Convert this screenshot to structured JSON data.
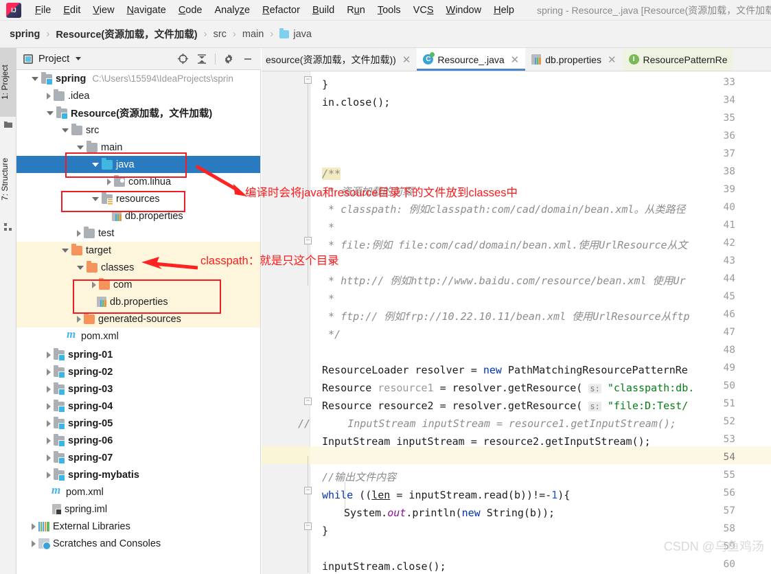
{
  "window": {
    "title": "spring - Resource_.java [Resource(资源加载，文件加载)"
  },
  "menubar": {
    "items": [
      {
        "label": "File"
      },
      {
        "label": "Edit"
      },
      {
        "label": "View"
      },
      {
        "label": "Navigate"
      },
      {
        "label": "Code"
      },
      {
        "label": "Analyze"
      },
      {
        "label": "Refactor"
      },
      {
        "label": "Build"
      },
      {
        "label": "Run"
      },
      {
        "label": "Tools"
      },
      {
        "label": "VCS"
      },
      {
        "label": "Window"
      },
      {
        "label": "Help"
      }
    ],
    "logo_icon": "intellij-idea-logo"
  },
  "breadcrumb": {
    "items": [
      {
        "label": "spring",
        "bold": true
      },
      {
        "label": "Resource(资源加载，文件加载)",
        "bold": true
      },
      {
        "label": "src",
        "bold": false
      },
      {
        "label": "main",
        "bold": false
      },
      {
        "label": "java",
        "bold": false,
        "icon": "folder-icon"
      }
    ],
    "separator": "›"
  },
  "tool_tabs": [
    {
      "label": "1: Project",
      "selected": true,
      "icon": "project-folder-icon"
    },
    {
      "label": "7: Structure",
      "selected": false,
      "icon": "structure-icon"
    }
  ],
  "project_panel": {
    "title": "Project",
    "title_icon": "project-icon",
    "dropdown_icon": "chevron-down-icon",
    "toolbar": [
      {
        "name": "locate-icon",
        "glyph": "⊕"
      },
      {
        "name": "collapse-all-icon",
        "glyph": "⬍"
      },
      {
        "name": "gear-icon",
        "glyph": "⚙"
      },
      {
        "name": "hide-icon",
        "glyph": "−"
      }
    ],
    "tree": [
      {
        "indent": 0,
        "arrow": "down",
        "icon": "module-folder-icon",
        "label": "spring",
        "bold": true,
        "path": "C:\\Users\\15594\\IdeaProjects\\sprin"
      },
      {
        "indent": 1,
        "arrow": "right",
        "icon": "folder-icon",
        "label": ".idea",
        "bold": false,
        "path": ""
      },
      {
        "indent": 1,
        "arrow": "down",
        "icon": "module-folder-icon",
        "label": "Resource(资源加载，文件加载)",
        "bold": true,
        "path": ""
      },
      {
        "indent": 2,
        "arrow": "down",
        "icon": "folder-icon",
        "label": "src",
        "bold": false,
        "path": ""
      },
      {
        "indent": 3,
        "arrow": "down",
        "icon": "folder-icon",
        "label": "main",
        "bold": false,
        "path": ""
      },
      {
        "indent": 4,
        "arrow": "down",
        "icon": "source-folder-icon",
        "label": "java",
        "bold": false,
        "path": "",
        "selected": true
      },
      {
        "indent": 5,
        "arrow": "right",
        "icon": "package-icon",
        "label": "com.lihua",
        "bold": false,
        "path": ""
      },
      {
        "indent": 4,
        "arrow": "down",
        "icon": "resources-folder-icon",
        "label": "resources",
        "bold": false,
        "path": ""
      },
      {
        "indent": 5,
        "arrow": "none",
        "icon": "properties-file-icon",
        "label": "db.properties",
        "bold": false,
        "path": ""
      },
      {
        "indent": 3,
        "arrow": "right",
        "icon": "folder-icon",
        "label": "test",
        "bold": false,
        "path": ""
      },
      {
        "indent": 2,
        "arrow": "down",
        "icon": "target-folder-icon",
        "label": "target",
        "bold": false,
        "path": "",
        "yellow": true
      },
      {
        "indent": 3,
        "arrow": "down",
        "icon": "target-folder-icon",
        "label": "classes",
        "bold": false,
        "path": "",
        "yellow": true
      },
      {
        "indent": 4,
        "arrow": "right",
        "icon": "target-folder-icon",
        "label": "com",
        "bold": false,
        "path": "",
        "yellow": true
      },
      {
        "indent": 4,
        "arrow": "none",
        "icon": "properties-file-icon",
        "label": "db.properties",
        "bold": false,
        "path": "",
        "yellow": true
      },
      {
        "indent": 3,
        "arrow": "right",
        "icon": "target-folder-icon",
        "label": "generated-sources",
        "bold": false,
        "path": "",
        "yellow": true
      },
      {
        "indent": 2,
        "arrow": "none",
        "icon": "maven-file-icon",
        "label": "pom.xml",
        "bold": false,
        "path": ""
      },
      {
        "indent": 1,
        "arrow": "right",
        "icon": "module-folder-icon",
        "label": "spring-01",
        "bold": true,
        "path": ""
      },
      {
        "indent": 1,
        "arrow": "right",
        "icon": "module-folder-icon",
        "label": "spring-02",
        "bold": true,
        "path": ""
      },
      {
        "indent": 1,
        "arrow": "right",
        "icon": "module-folder-icon",
        "label": "spring-03",
        "bold": true,
        "path": ""
      },
      {
        "indent": 1,
        "arrow": "right",
        "icon": "module-folder-icon",
        "label": "spring-04",
        "bold": true,
        "path": ""
      },
      {
        "indent": 1,
        "arrow": "right",
        "icon": "module-folder-icon",
        "label": "spring-05",
        "bold": true,
        "path": ""
      },
      {
        "indent": 1,
        "arrow": "right",
        "icon": "module-folder-icon",
        "label": "spring-06",
        "bold": true,
        "path": ""
      },
      {
        "indent": 1,
        "arrow": "right",
        "icon": "module-folder-icon",
        "label": "spring-07",
        "bold": true,
        "path": ""
      },
      {
        "indent": 1,
        "arrow": "right",
        "icon": "module-folder-icon",
        "label": "spring-mybatis",
        "bold": true,
        "path": ""
      },
      {
        "indent": 1,
        "arrow": "none",
        "icon": "maven-file-icon",
        "label": "pom.xml",
        "bold": false,
        "path": ""
      },
      {
        "indent": 1,
        "arrow": "none",
        "icon": "iml-file-icon",
        "label": "spring.iml",
        "bold": false,
        "path": ""
      },
      {
        "indent": 0,
        "arrow": "right",
        "icon": "libraries-icon",
        "label": "External Libraries",
        "bold": false,
        "path": ""
      },
      {
        "indent": 0,
        "arrow": "right",
        "icon": "scratches-icon",
        "label": "Scratches and Consoles",
        "bold": false,
        "path": ""
      }
    ]
  },
  "editor_tabs": [
    {
      "label": "esource(资源加载，文件加载))",
      "active": false,
      "icon": "",
      "close": "×"
    },
    {
      "label": "Resource_.java",
      "active": true,
      "icon": "java-class-icon",
      "close": "×"
    },
    {
      "label": "db.properties",
      "active": false,
      "icon": "properties-file-icon",
      "close": "×"
    },
    {
      "label": "ResourcePatternRe",
      "active": false,
      "icon": "java-interface-icon",
      "close": ""
    }
  ],
  "editor": {
    "first_line_number": 33,
    "current_line": 54,
    "lines": [
      {
        "n": 33,
        "text": "    }"
      },
      {
        "n": 34,
        "text": "    in.close();"
      },
      {
        "n": 35,
        "text": ""
      },
      {
        "n": 36,
        "text": ""
      },
      {
        "n": 37,
        "text": ""
      },
      {
        "n": 38,
        "text": "    /**"
      },
      {
        "n": 39,
        "text": "     * 资源加载的前缀"
      },
      {
        "n": 40,
        "text": "     * classpath: 例如classpath:com/cad/domain/bean.xml。从类路径"
      },
      {
        "n": 41,
        "text": "     *"
      },
      {
        "n": 42,
        "text": "     * file:例如 file:com/cad/domain/bean.xml.使用UrlResource从文"
      },
      {
        "n": 43,
        "text": "     *"
      },
      {
        "n": 44,
        "text": "     * http:// 例如http://www.baidu.com/resource/bean.xml 使用Ur"
      },
      {
        "n": 45,
        "text": "     *"
      },
      {
        "n": 46,
        "text": "     * ftp:// 例如frp://10.22.10.11/bean.xml 使用UrlResource从ftp"
      },
      {
        "n": 47,
        "text": "     */"
      },
      {
        "n": 48,
        "text": ""
      },
      {
        "n": 49,
        "text": "    ResourceLoader resolver = new PathMatchingResourcePatternRe"
      },
      {
        "n": 50,
        "text": "    Resource resource1 = resolver.getResource( s: \"classpath:db."
      },
      {
        "n": 51,
        "text": "    Resource resource2 = resolver.getResource( s: \"file:D:Test/"
      },
      {
        "n": 52,
        "text": "//      InputStream inputStream = resource1.getInputStream();"
      },
      {
        "n": 53,
        "text": "    InputStream inputStream = resource2.getInputStream();"
      },
      {
        "n": 54,
        "text": ""
      },
      {
        "n": 55,
        "text": "    //输出文件内容"
      },
      {
        "n": 56,
        "text": "    while ((len = inputStream.read(b))!=-1){"
      },
      {
        "n": 57,
        "text": "        System.out.println(new String(b));"
      },
      {
        "n": 58,
        "text": "    }"
      },
      {
        "n": 59,
        "text": ""
      },
      {
        "n": 60,
        "text": "    inputStream.close();"
      }
    ]
  },
  "annotations": [
    {
      "name": "note-compile",
      "text": "编译时会将java和resource目录下的文件放到classes中"
    },
    {
      "name": "note-classpath",
      "text": "classpath：就是只这个目录"
    }
  ],
  "watermark": "CSDN @乌鱼鸡汤",
  "colors": {
    "selection_blue": "#2a7ac0",
    "annotation_red": "#fc1b1b",
    "target_yellow": "#fdf6dd",
    "tab_underline": "#4a88c7"
  }
}
